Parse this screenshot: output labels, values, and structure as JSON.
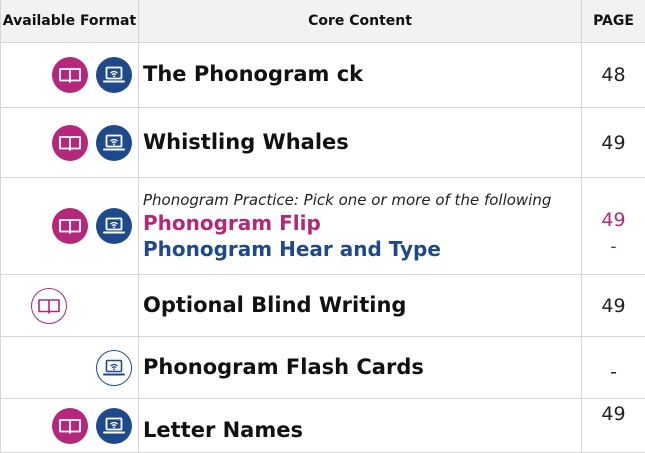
{
  "header": {
    "format": "Available Format",
    "content": "Core Content",
    "page": "PAGE"
  },
  "colors": {
    "book": "#b5277a",
    "laptop": "#1e4a8c"
  },
  "rows": [
    {
      "icons": [
        "book-icon",
        "laptop-icon"
      ],
      "title": "The Phonogram ck",
      "page": "48"
    },
    {
      "icons": [
        "book-icon",
        "laptop-icon"
      ],
      "title": "Whistling Whales",
      "page": "49"
    },
    {
      "icons": [
        "book-icon",
        "laptop-icon"
      ],
      "intro": "Phonogram Practice: Pick one or more of the following",
      "option1": {
        "title": "Phonogram Flip",
        "page": "49"
      },
      "option2": {
        "title": "Phonogram Hear and Type",
        "page": "-"
      }
    },
    {
      "icons": [
        "book-outline-icon"
      ],
      "title": "Optional Blind Writing",
      "page": "49"
    },
    {
      "icons": [
        "laptop-outline-icon"
      ],
      "title": "Phonogram Flash Cards",
      "page": "-"
    },
    {
      "icons": [
        "book-icon",
        "laptop-icon"
      ],
      "title": "Letter Names",
      "page": "49"
    }
  ]
}
